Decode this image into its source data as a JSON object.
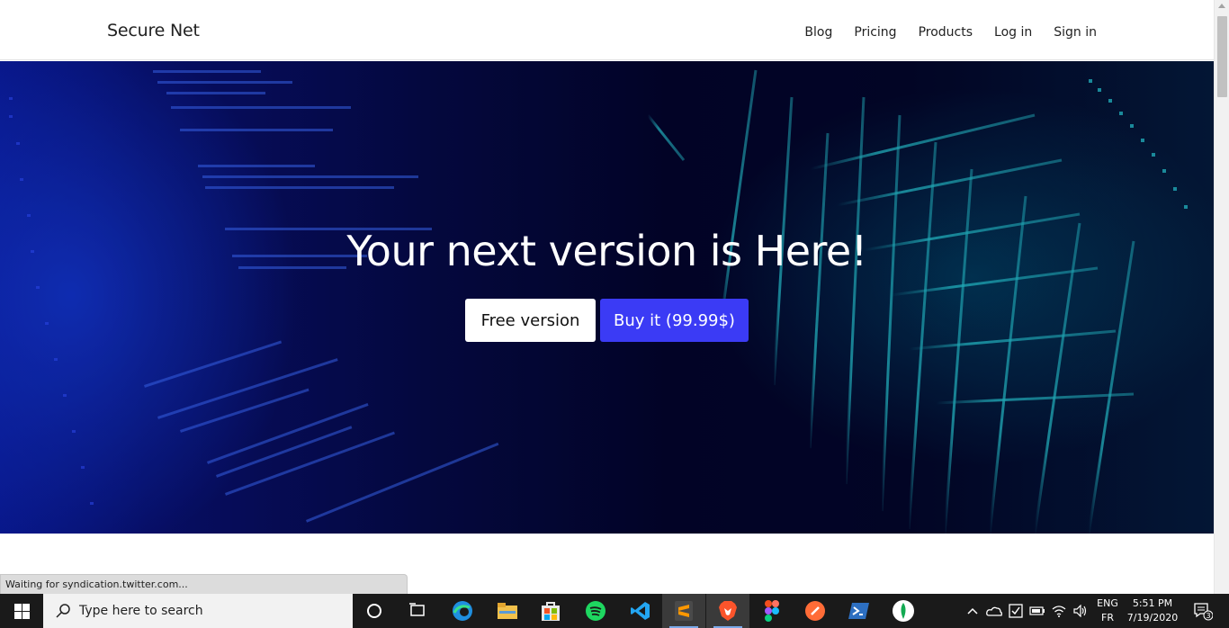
{
  "site": {
    "brand": "Secure Net",
    "nav": [
      "Blog",
      "Pricing",
      "Products",
      "Log in",
      "Sign in"
    ]
  },
  "hero": {
    "title": "Your next version is Here!",
    "free_button": "Free version",
    "buy_button": "Buy it (99.99$)"
  },
  "status_bar": {
    "text": "Waiting for syndication.twitter.com..."
  },
  "taskbar": {
    "search_placeholder": "Type here to search",
    "apps": [
      "cortana-icon",
      "task-view-icon",
      "edge-icon",
      "file-explorer-icon",
      "store-icon",
      "spotify-icon",
      "vscode-icon",
      "sublime-icon",
      "brave-icon",
      "figma-icon",
      "postman-icon",
      "powershell-icon",
      "mongodb-icon"
    ],
    "language_top": "ENG",
    "language_bottom": "FR",
    "time": "5:51 PM",
    "date": "7/19/2020",
    "notifications": "3"
  },
  "colors": {
    "accent": "#3b3bf5",
    "hero_bg": "#03042a",
    "taskbar_bg": "#1a1a1a"
  }
}
